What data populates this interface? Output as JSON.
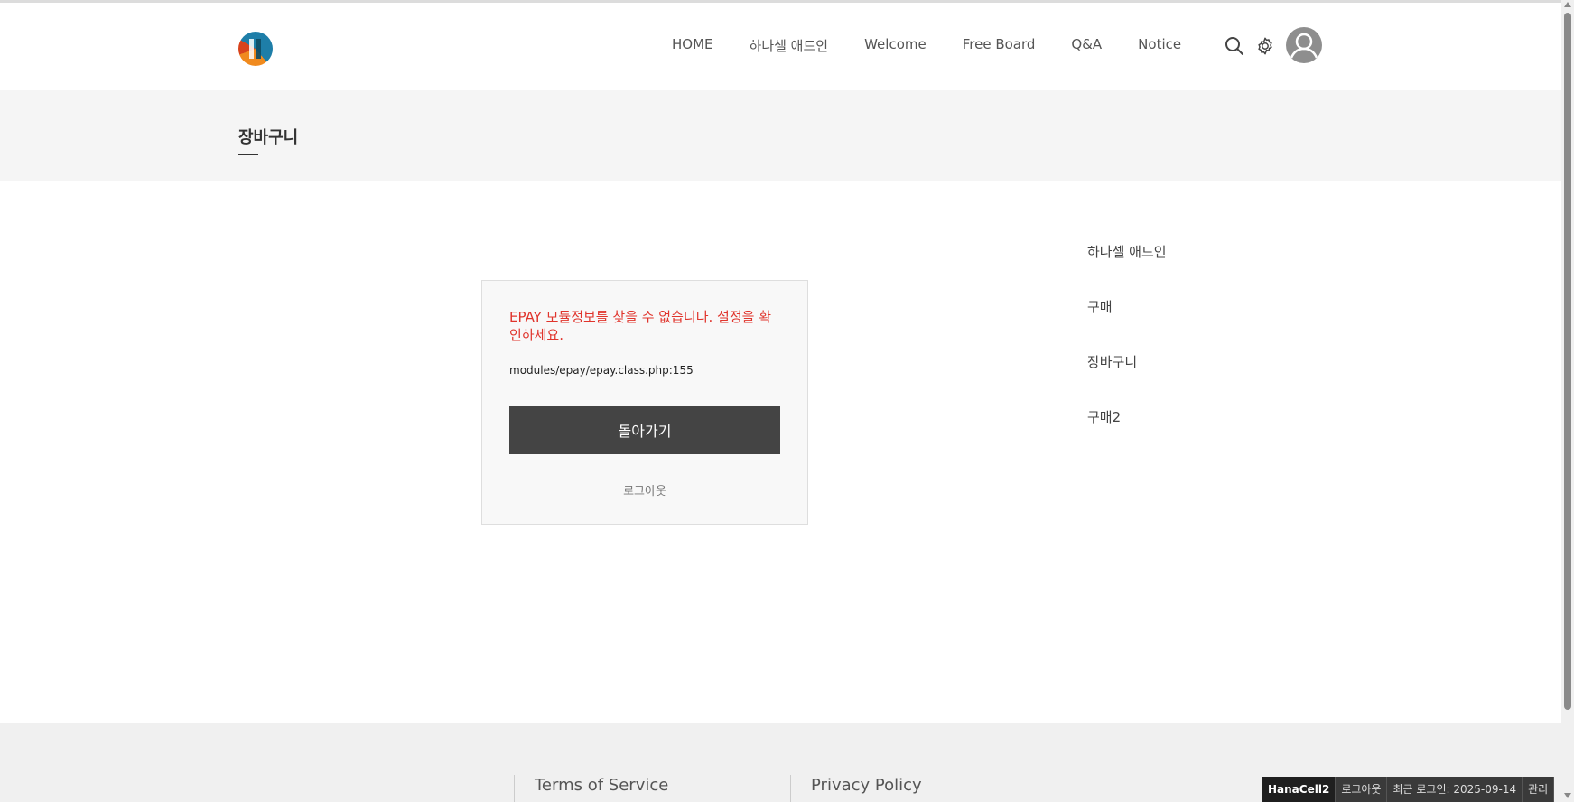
{
  "header": {
    "logo_icon": "hanacell-logo-icon",
    "nav": [
      "HOME",
      "하나셀 애드인",
      "Welcome",
      "Free Board",
      "Q&A",
      "Notice"
    ],
    "search_icon": "search-icon",
    "settings_icon": "gear-icon",
    "avatar_icon": "user-avatar-icon"
  },
  "page": {
    "title": "장바구니"
  },
  "error": {
    "message": "EPAY 모듈정보를 찾을 수 없습니다. 설정을 확인하세요.",
    "path": "modules/epay/epay.class.php:155",
    "back_label": "돌아가기",
    "logout_label": "로그아웃",
    "message_color": "#e0342c",
    "button_color": "#444444"
  },
  "sidebar": {
    "items": [
      "하나셀 애드인",
      "구매",
      "장바구니",
      "구매2"
    ]
  },
  "footer": {
    "terms": "Terms of Service",
    "privacy": "Privacy Policy"
  },
  "admin_bar": {
    "site": "HanaCell2",
    "logout": "로그아웃",
    "last_login": "최근 로그인: 2025-09-14",
    "manage": "관리"
  }
}
